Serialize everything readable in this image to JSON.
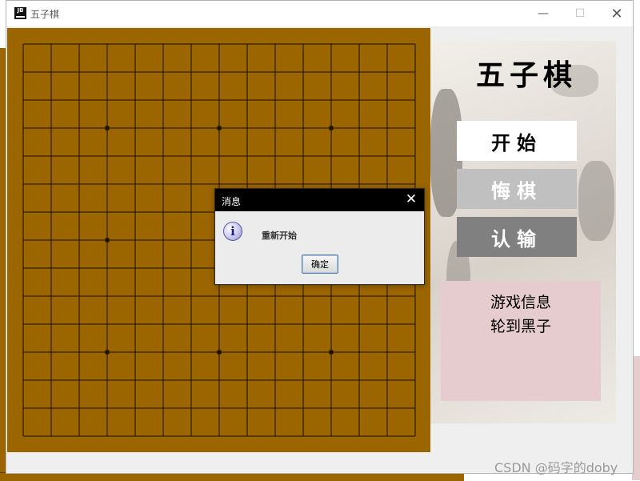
{
  "window": {
    "title": "五子棋",
    "app_icon_text": "JB",
    "minimize_glyph": "—",
    "maximize_glyph": "☐",
    "close_glyph": "✕"
  },
  "board": {
    "grid_lines": 15,
    "star_points": [
      [
        3,
        3
      ],
      [
        3,
        7
      ],
      [
        3,
        11
      ],
      [
        7,
        3
      ],
      [
        7,
        11
      ],
      [
        11,
        3
      ],
      [
        11,
        7
      ],
      [
        11,
        11
      ]
    ],
    "wood_color": "#9b6500",
    "line_color": "#1a1000"
  },
  "side_panel": {
    "title": "五子棋",
    "buttons": {
      "start": "开始",
      "undo": "悔棋",
      "surrender": "认输"
    }
  },
  "info_panel": {
    "title": "游戏信息",
    "turn": "轮到黑子",
    "background": "#e6cccf"
  },
  "dialog": {
    "title": "消息",
    "icon": "information-icon",
    "icon_glyph": "i",
    "message": "重新开始",
    "ok_label": "确定",
    "close_glyph": "✕"
  },
  "watermark": "CSDN @码字的doby"
}
